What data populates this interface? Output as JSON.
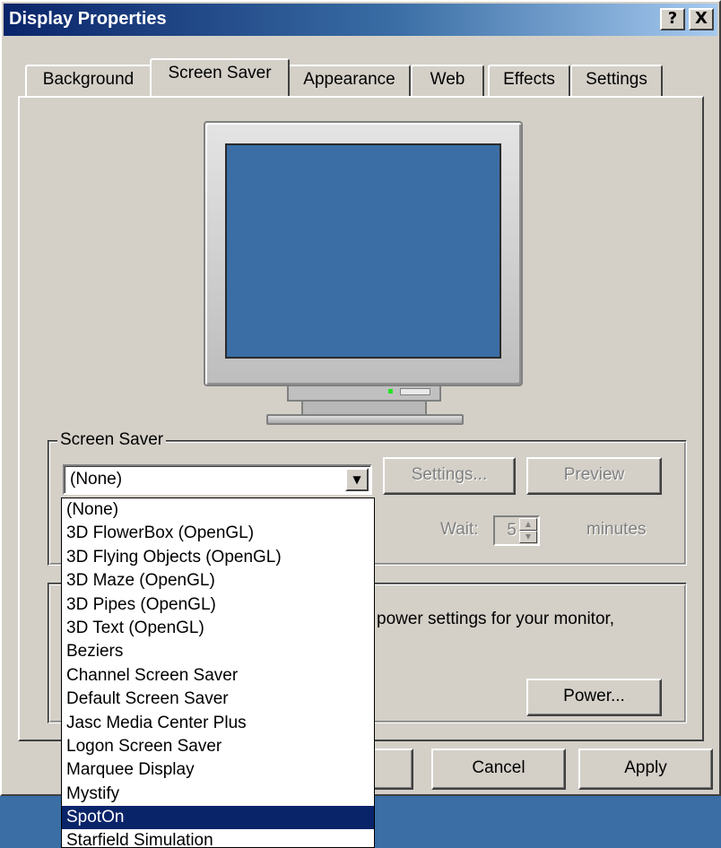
{
  "window": {
    "title": "Display Properties",
    "help_btn": "?",
    "close_btn": "X"
  },
  "tabs": [
    {
      "label": "Background"
    },
    {
      "label": "Screen Saver",
      "active": true
    },
    {
      "label": "Appearance"
    },
    {
      "label": "Web"
    },
    {
      "label": "Effects"
    },
    {
      "label": "Settings"
    }
  ],
  "screensaver": {
    "group_label": "Screen Saver",
    "selected": "(None)",
    "settings_btn": "Settings...",
    "preview_btn": "Preview",
    "wait_label": "Wait:",
    "wait_value": "5",
    "minutes_label": "minutes",
    "list": [
      "(None)",
      "3D FlowerBox (OpenGL)",
      "3D Flying Objects (OpenGL)",
      "3D Maze (OpenGL)",
      "3D Pipes (OpenGL)",
      "3D Text (OpenGL)",
      "Beziers",
      "Channel Screen Saver",
      "Default Screen Saver",
      "Jasc Media Center Plus",
      "Logon Screen Saver",
      "Marquee Display",
      "Mystify",
      "SpotOn",
      "Starfield Simulation"
    ],
    "highlighted": "SpotOn"
  },
  "power": {
    "text": "power settings for your monitor,",
    "button": "Power..."
  },
  "footer": {
    "cancel": "Cancel",
    "apply": "Apply"
  },
  "colors": {
    "title_start": "#0a246a",
    "title_end": "#a6caf0",
    "face": "#d4d0c8",
    "desktop": "#3a6ea5",
    "selection": "#0a246a"
  }
}
